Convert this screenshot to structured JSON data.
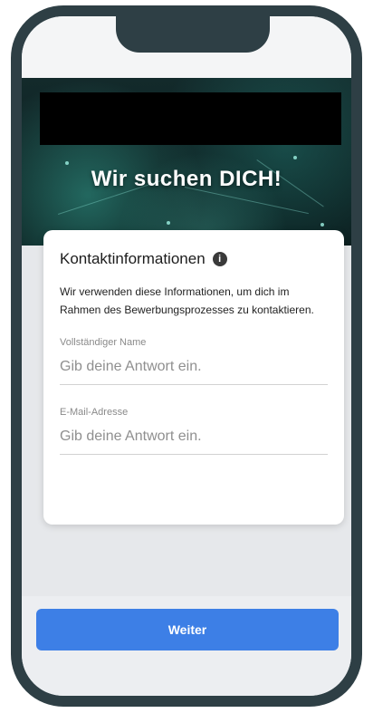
{
  "banner": {
    "title": "Wir suchen DICH!"
  },
  "card": {
    "title": "Kontaktinformationen",
    "info_icon": "info-icon",
    "description": "Wir verwenden diese Informationen, um dich im Rahmen des Bewerbungsprozesses zu kontaktieren.",
    "fields": [
      {
        "label": "Vollständiger Name",
        "placeholder": "Gib deine Antwort ein.",
        "value": ""
      },
      {
        "label": "E-Mail-Adresse",
        "placeholder": "Gib deine Antwort ein.",
        "value": ""
      }
    ]
  },
  "footer": {
    "next_label": "Weiter"
  },
  "colors": {
    "accent": "#3d7fe6",
    "phone_frame": "#2e3f45",
    "banner_bg": "#0b1c1d"
  }
}
